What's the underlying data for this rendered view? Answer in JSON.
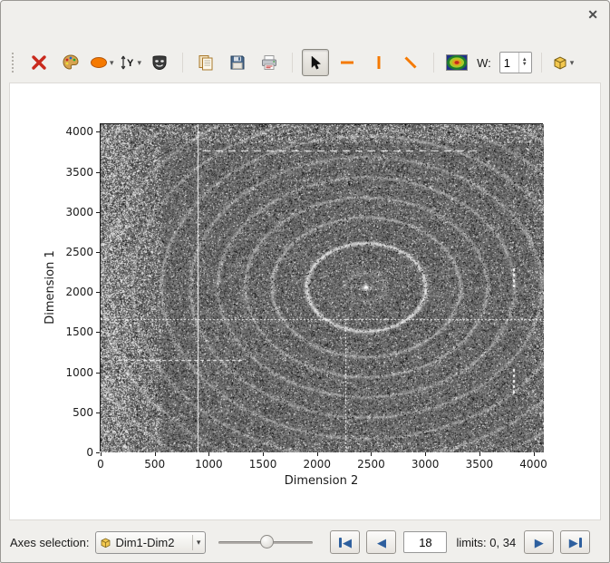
{
  "icons": {
    "close": "✕",
    "dropdown": "▾",
    "spin_up": "▲",
    "spin_down": "▼",
    "nav_prev": "◀",
    "nav_next": "▶",
    "toolbar": [
      "clear-red-x",
      "palette",
      "ellipse-tool",
      "y-axis-scale",
      "mask-tool",
      "copy",
      "save",
      "print",
      "pointer-select",
      "horizontal-profile",
      "vertical-profile",
      "diagonal-profile",
      "colormap-thumbnail",
      "cube-3d"
    ]
  },
  "toolbar": {
    "w_label": "W:",
    "w_value": "1"
  },
  "footer": {
    "axes_label": "Axes selection:",
    "axes_value": "Dim1-Dim2",
    "frame_value": "18",
    "limits_label": "limits: 0, 34"
  },
  "chart_data": {
    "type": "heatmap",
    "title": "",
    "xlabel": "Dimension 2",
    "ylabel": "Dimension 1",
    "xlim": [
      0,
      4096
    ],
    "ylim": [
      0,
      4096
    ],
    "x_ticks": [
      0,
      500,
      1000,
      1500,
      2000,
      2500,
      3000,
      3500,
      4000
    ],
    "y_ticks": [
      0,
      500,
      1000,
      1500,
      2000,
      2500,
      3000,
      3500,
      4000
    ],
    "legend": "none",
    "grid": false,
    "description": "Grayscale X-ray powder diffraction detector frame: concentric Debye-Scherrer rings around a bright beam center on a noisy speckled background; dense white speckle near left/top edges; white cursor marker lines.",
    "ring_center": {
      "x": 2455,
      "y": 2060
    },
    "rings": [
      [
        180,
        25,
        24
      ],
      [
        550,
        105,
        15
      ],
      [
        870,
        55,
        13
      ],
      [
        1120,
        50,
        13
      ],
      [
        1370,
        48,
        13
      ],
      [
        1625,
        45,
        13
      ],
      [
        1890,
        45,
        13
      ],
      [
        2160,
        43,
        13
      ],
      [
        2440,
        41,
        13
      ],
      [
        2720,
        39,
        13
      ],
      [
        3010,
        37,
        13
      ],
      [
        3300,
        35,
        13
      ],
      [
        3590,
        33,
        13
      ]
    ],
    "markers": {
      "solid_vline_x": 900,
      "dotted_hline_y": 1660,
      "dotted_vline_x": 2265,
      "dash_segment": {
        "y": 1150,
        "x_range": [
          160,
          1280
        ]
      },
      "top_dashes": {
        "y": 3770,
        "x_range": [
          950,
          3450
        ]
      },
      "right_dashes": [
        {
          "x": 3815,
          "y_range": [
            2090,
            2300
          ]
        },
        {
          "x": 3815,
          "y_range": [
            760,
            1040
          ]
        }
      ]
    }
  }
}
